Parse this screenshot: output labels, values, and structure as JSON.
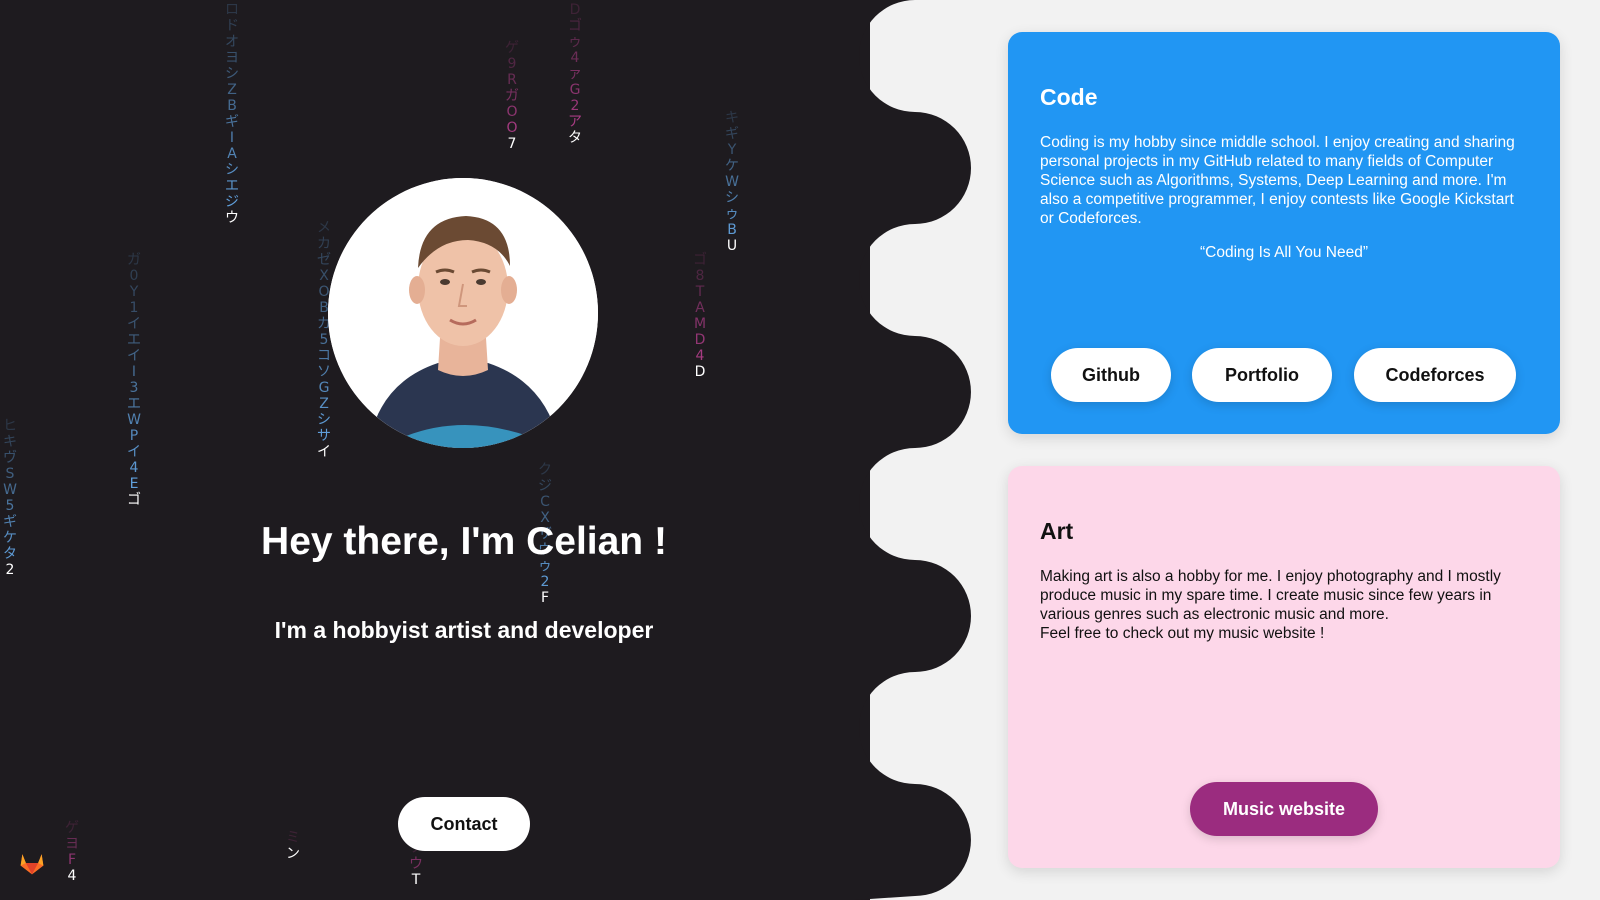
{
  "hero": {
    "title": "Hey there, I'm Celian !",
    "subtitle": "I'm a hobbyist artist and developer",
    "contact_label": "Contact"
  },
  "code_card": {
    "title": "Code",
    "text": "Coding is my hobby since middle school. I enjoy creating and sharing personal projects in my GitHub related to many fields of Computer Science such as Algorithms, Systems, Deep Learning and more. I'm also a competitive programmer, I enjoy contests like Google Kickstart or Codeforces.",
    "quote": "“Coding Is All You Need”",
    "buttons": [
      "Github",
      "Portfolio",
      "Codeforces"
    ]
  },
  "art_card": {
    "title": "Art",
    "text_line1": "Making art is also a hobby for me. I enjoy photography and I mostly produce music in my spare time. I create music since few years in various genres such as electronic music and more.",
    "text_line2": "Feel free to check out my music website !",
    "button": "Music website"
  },
  "matrix_columns": [
    {
      "chars": "ロドオヨシZBギIAシエジウ",
      "color": "#64a7e6"
    },
    {
      "chars": "ガ0Y1イエイI3エWPイ4Eゴ",
      "color": "#64a7e6"
    },
    {
      "chars": "メカゼXOBカ5コソGZシサイ",
      "color": "#64a7e6"
    },
    {
      "chars": "ゲ9RガOO7",
      "color": "#b73f8e"
    },
    {
      "chars": "Dゴゥ4ァG2アタ",
      "color": "#b73f8e"
    },
    {
      "chars": "キギYケWシゥBU",
      "color": "#64a7e6"
    },
    {
      "chars": "ゴ8TAMD4D",
      "color": "#b73f8e"
    },
    {
      "chars": "ヒキヴSW5ギケタ2",
      "color": "#64a7e6"
    },
    {
      "chars": "クジCXザウゥ2F",
      "color": "#64a7e6"
    },
    {
      "chars": "ゲヨF4",
      "color": "#b73f8e"
    },
    {
      "chars": "ミン",
      "color": "#b73f8e"
    },
    {
      "chars": "ゾウT",
      "color": "#b73f8e"
    }
  ],
  "colors": {
    "dark_background": "#1e1b1f",
    "code_card": "#2196f3",
    "art_card": "#fdd7e9",
    "music_button": "#9b2c7f",
    "page_background": "#f2f2f2"
  },
  "icons": {
    "footer_link": "gitlab-icon"
  }
}
